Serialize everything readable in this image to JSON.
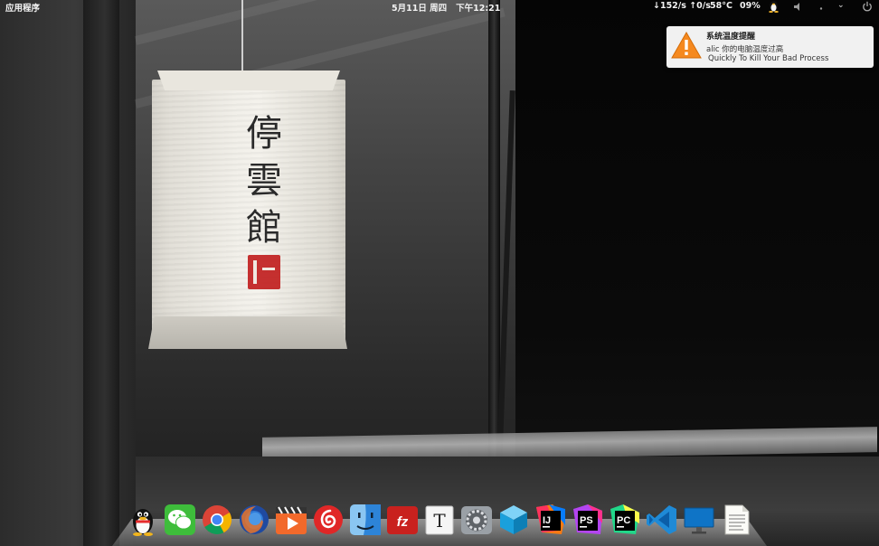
{
  "top_panel": {
    "apps_menu_label": "应用程序",
    "date": "5月11日 周四",
    "time": "下午12:21",
    "network_speed": "↓152/s ↑0/s",
    "cpu_temp": "58°C",
    "cpu_usage": "09%"
  },
  "wallpaper": {
    "lantern_text": [
      "停",
      "雲",
      "館"
    ]
  },
  "notification": {
    "title": "系统温度提醒",
    "line1": "alic 你的电脑温度过高",
    "line2": " Quickly To Kill Your Bad Process",
    "icon": "warning-icon"
  },
  "dock": {
    "items": [
      {
        "name": "qq",
        "icon": "qq-penguin-icon"
      },
      {
        "name": "wechat",
        "icon": "wechat-icon"
      },
      {
        "name": "chrome",
        "icon": "chrome-icon"
      },
      {
        "name": "firefox",
        "icon": "firefox-icon"
      },
      {
        "name": "video-player",
        "icon": "video-player-icon"
      },
      {
        "name": "netease-music",
        "icon": "netease-music-icon"
      },
      {
        "name": "finder",
        "icon": "finder-icon"
      },
      {
        "name": "filezilla",
        "icon": "filezilla-icon"
      },
      {
        "name": "typora",
        "icon": "typora-icon"
      },
      {
        "name": "settings",
        "icon": "settings-gear-icon"
      },
      {
        "name": "virtualbox",
        "icon": "cube-icon"
      },
      {
        "name": "intellij",
        "icon": "intellij-icon"
      },
      {
        "name": "phpstorm",
        "icon": "phpstorm-icon"
      },
      {
        "name": "pycharm",
        "icon": "pycharm-icon"
      },
      {
        "name": "vscode",
        "icon": "vscode-icon"
      },
      {
        "name": "display",
        "icon": "monitor-icon"
      },
      {
        "name": "text-editor",
        "icon": "document-icon"
      }
    ],
    "labels": {
      "filezilla": "fz",
      "typora": "T",
      "intellij": "IJ",
      "phpstorm": "PS",
      "pycharm": "PC"
    }
  },
  "colors": {
    "panel_text": "#f2f2f2",
    "notification_bg": "#f1f1f1",
    "warning": "#f5891f"
  }
}
